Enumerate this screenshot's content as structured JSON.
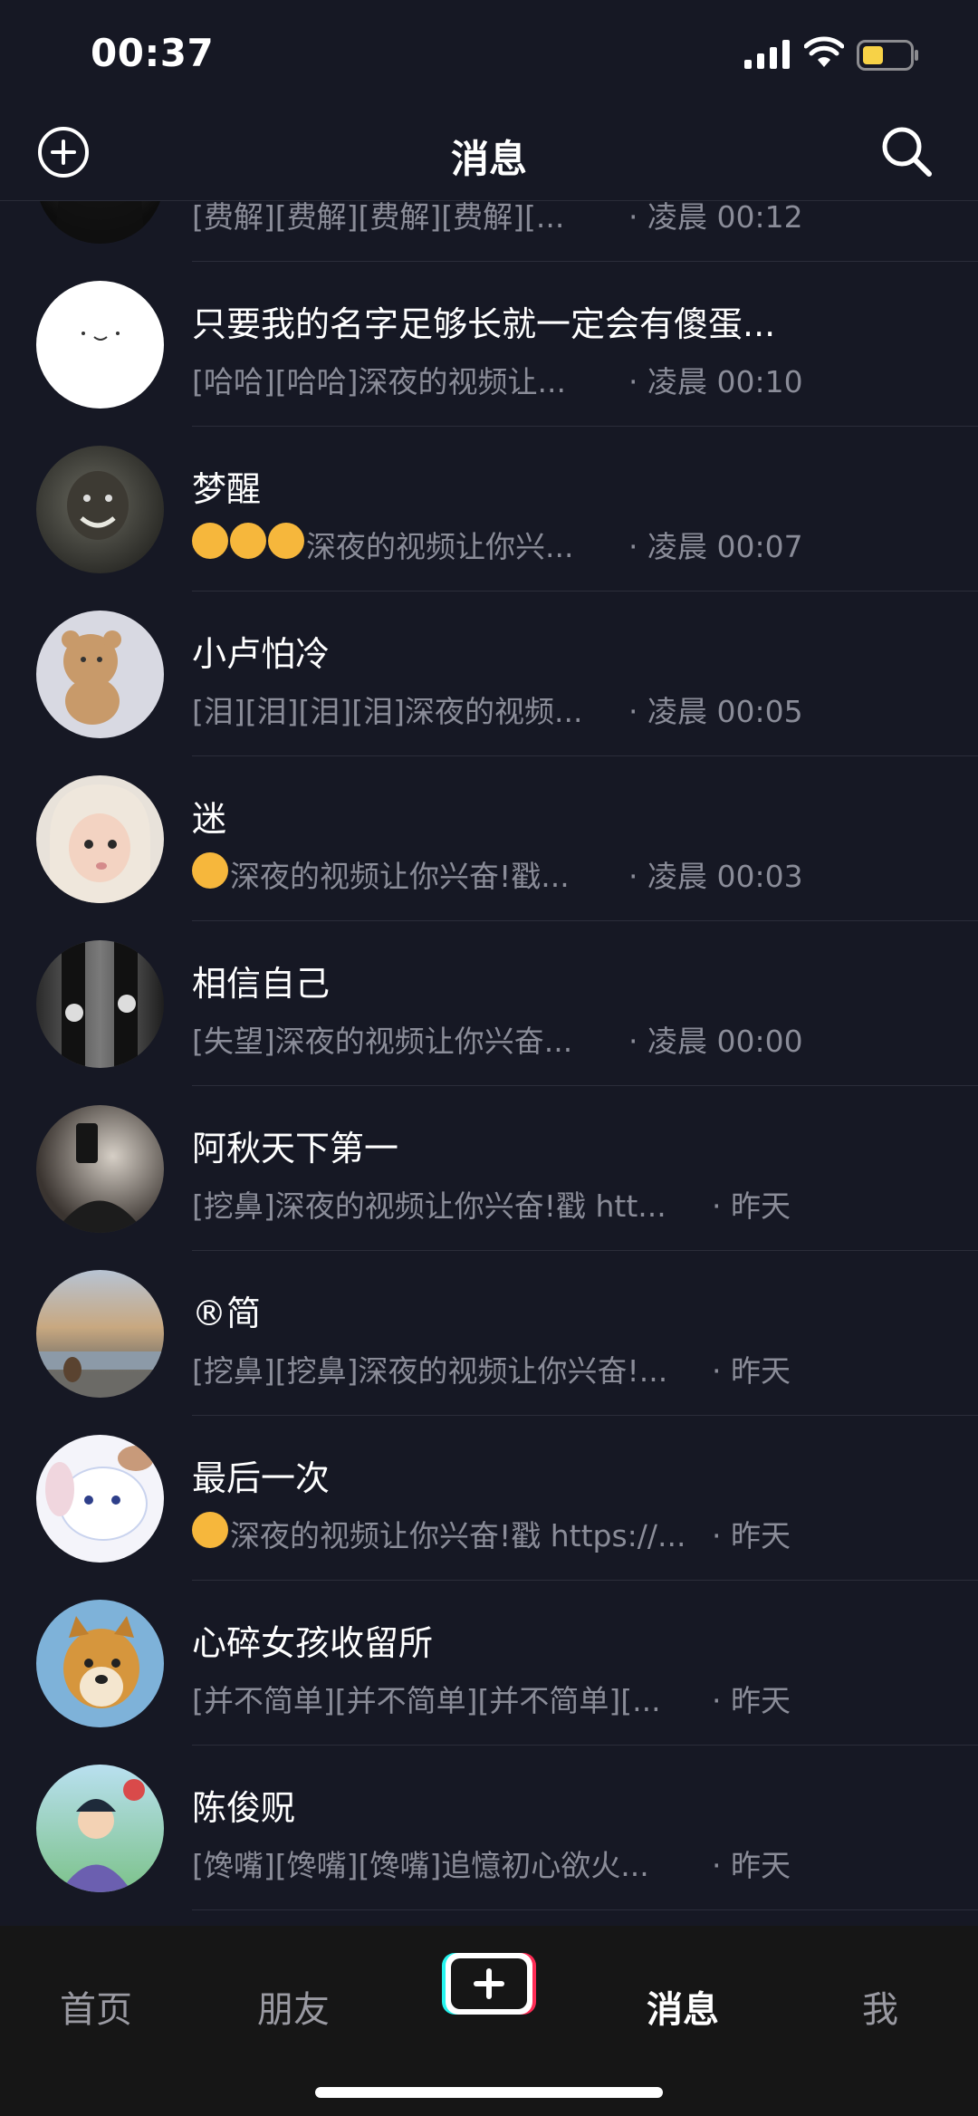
{
  "status_bar": {
    "time": "00:37"
  },
  "header": {
    "title": "消息"
  },
  "messages": [
    {
      "name": "",
      "preview": "[费解][费解][费解][费解][...",
      "time": "凌晨 00:12"
    },
    {
      "name": "只要我的名字足够长就一定会有傻蛋...",
      "preview": "[哈哈][哈哈]深夜的视频让...",
      "time": "凌晨 00:10"
    },
    {
      "name": "梦醒",
      "preview": "深夜的视频让你兴...",
      "time": "凌晨 00:07"
    },
    {
      "name": "小卢怕冷",
      "preview": "[泪][泪][泪][泪]深夜的视频...",
      "time": "凌晨 00:05"
    },
    {
      "name": "迷",
      "preview": "深夜的视频让你兴奋!戳...",
      "time": "凌晨 00:03"
    },
    {
      "name": "相信自己",
      "preview": "[失望]深夜的视频让你兴奋...",
      "time": "凌晨 00:00"
    },
    {
      "name": "阿秋天下第一",
      "preview": "[挖鼻]深夜的视频让你兴奋!戳 htt...",
      "time": "昨天"
    },
    {
      "name": "®简",
      "preview": "[挖鼻][挖鼻]深夜的视频让你兴奋!...",
      "time": "昨天"
    },
    {
      "name": "最后一次",
      "preview": "深夜的视频让你兴奋!戳 https://...",
      "time": "昨天"
    },
    {
      "name": "心碎女孩收留所",
      "preview": "[并不简单][并不简单][并不简单][...",
      "time": "昨天"
    },
    {
      "name": "陈俊贶",
      "preview": "[馋嘴][馋嘴][馋嘴]追憶初心欲火...",
      "time": "昨天"
    }
  ],
  "tab_bar": {
    "home": "首页",
    "friends": "朋友",
    "messages": "消息",
    "me": "我"
  }
}
